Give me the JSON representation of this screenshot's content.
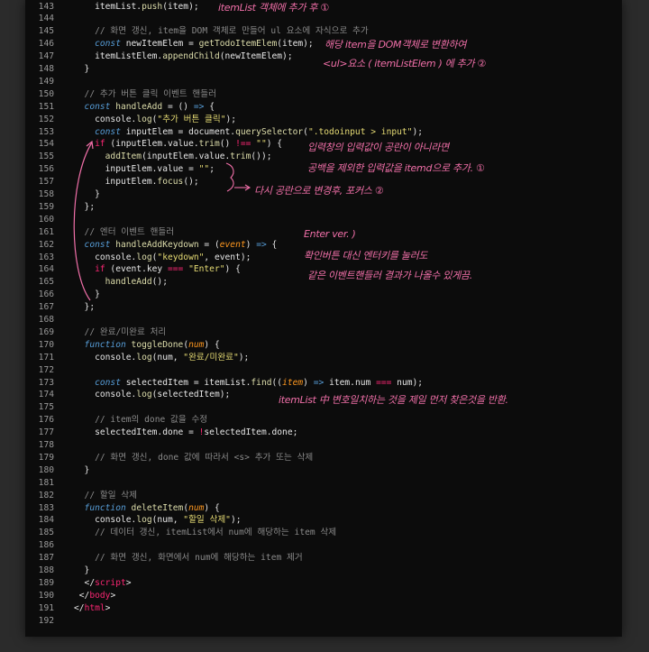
{
  "colors": {
    "background": "#0c0c0c",
    "line_number": "#9a9a9a",
    "plain": "#e6e6e6",
    "keyword": "#569cd6",
    "function": "#dcdcaa",
    "string": "#e6db74",
    "comment": "#8a8a8a",
    "param": "#fd971f",
    "operator": "#f92672",
    "annotation": "#f06fa8"
  },
  "code_lines": [
    {
      "n": "143",
      "tokens": [
        [
          "p",
          "    itemList."
        ],
        [
          "f",
          "push"
        ],
        [
          "p",
          "(item);"
        ]
      ]
    },
    {
      "n": "144",
      "tokens": []
    },
    {
      "n": "145",
      "tokens": [
        [
          "c",
          "    // 화면 갱신, item을 DOM 객체로 만들어 ul 요소에 자식으로 추가"
        ]
      ]
    },
    {
      "n": "146",
      "tokens": [
        [
          "k",
          "    const"
        ],
        [
          "p",
          " newItemElem = "
        ],
        [
          "f",
          "getTodoItemElem"
        ],
        [
          "p",
          "(item);"
        ]
      ]
    },
    {
      "n": "147",
      "tokens": [
        [
          "p",
          "    itemListElem."
        ],
        [
          "f",
          "appendChild"
        ],
        [
          "p",
          "(newItemElem);"
        ]
      ]
    },
    {
      "n": "148",
      "tokens": [
        [
          "p",
          "  }"
        ]
      ]
    },
    {
      "n": "149",
      "tokens": []
    },
    {
      "n": "150",
      "tokens": [
        [
          "c",
          "  // 추가 버튼 클릭 이벤트 핸들러"
        ]
      ]
    },
    {
      "n": "151",
      "tokens": [
        [
          "k",
          "  const"
        ],
        [
          "f",
          " handleAdd"
        ],
        [
          "p",
          " = () "
        ],
        [
          "k",
          "=>"
        ],
        [
          "p",
          " {"
        ]
      ]
    },
    {
      "n": "152",
      "tokens": [
        [
          "p",
          "    console."
        ],
        [
          "f",
          "log"
        ],
        [
          "p",
          "("
        ],
        [
          "s",
          "\"추가 버튼 클릭\""
        ],
        [
          "p",
          ");"
        ]
      ]
    },
    {
      "n": "153",
      "tokens": [
        [
          "k",
          "    const"
        ],
        [
          "p",
          " inputElem = document."
        ],
        [
          "f",
          "querySelector"
        ],
        [
          "p",
          "("
        ],
        [
          "s",
          "\".todoinput > input\""
        ],
        [
          "p",
          ");"
        ]
      ]
    },
    {
      "n": "154",
      "tokens": [
        [
          "o",
          "    if"
        ],
        [
          "p",
          " (inputElem.value."
        ],
        [
          "f",
          "trim"
        ],
        [
          "p",
          "() "
        ],
        [
          "o",
          "!=="
        ],
        [
          "p",
          " "
        ],
        [
          "s",
          "\"\""
        ],
        [
          "p",
          ") {"
        ]
      ]
    },
    {
      "n": "155",
      "tokens": [
        [
          "f",
          "      addItem"
        ],
        [
          "p",
          "(inputElem.value."
        ],
        [
          "f",
          "trim"
        ],
        [
          "p",
          "());"
        ]
      ]
    },
    {
      "n": "156",
      "tokens": [
        [
          "p",
          "      inputElem.value = "
        ],
        [
          "s",
          "\"\""
        ],
        [
          "p",
          ";"
        ]
      ]
    },
    {
      "n": "157",
      "tokens": [
        [
          "p",
          "      inputElem."
        ],
        [
          "f",
          "focus"
        ],
        [
          "p",
          "();"
        ]
      ]
    },
    {
      "n": "158",
      "tokens": [
        [
          "p",
          "    }"
        ]
      ]
    },
    {
      "n": "159",
      "tokens": [
        [
          "p",
          "  };"
        ]
      ]
    },
    {
      "n": "160",
      "tokens": []
    },
    {
      "n": "161",
      "tokens": [
        [
          "c",
          "  // 엔터 이벤트 핸들러"
        ]
      ]
    },
    {
      "n": "162",
      "tokens": [
        [
          "k",
          "  const"
        ],
        [
          "f",
          " handleAddKeydown"
        ],
        [
          "p",
          " = ("
        ],
        [
          "a",
          "event"
        ],
        [
          "p",
          ") "
        ],
        [
          "k",
          "=>"
        ],
        [
          "p",
          " {"
        ]
      ]
    },
    {
      "n": "163",
      "tokens": [
        [
          "p",
          "    console."
        ],
        [
          "f",
          "log"
        ],
        [
          "p",
          "("
        ],
        [
          "s",
          "\"keydown\""
        ],
        [
          "p",
          ", event);"
        ]
      ]
    },
    {
      "n": "164",
      "tokens": [
        [
          "o",
          "    if"
        ],
        [
          "p",
          " (event.key "
        ],
        [
          "o",
          "==="
        ],
        [
          "p",
          " "
        ],
        [
          "s",
          "\"Enter\""
        ],
        [
          "p",
          ") {"
        ]
      ]
    },
    {
      "n": "165",
      "tokens": [
        [
          "f",
          "      handleAdd"
        ],
        [
          "p",
          "();"
        ]
      ]
    },
    {
      "n": "166",
      "tokens": [
        [
          "p",
          "    }"
        ]
      ]
    },
    {
      "n": "167",
      "tokens": [
        [
          "p",
          "  };"
        ]
      ]
    },
    {
      "n": "168",
      "tokens": []
    },
    {
      "n": "169",
      "tokens": [
        [
          "c",
          "  // 완료/미완료 처리"
        ]
      ]
    },
    {
      "n": "170",
      "tokens": [
        [
          "k",
          "  function"
        ],
        [
          "f",
          " toggleDone"
        ],
        [
          "p",
          "("
        ],
        [
          "a",
          "num"
        ],
        [
          "p",
          ") {"
        ]
      ]
    },
    {
      "n": "171",
      "tokens": [
        [
          "p",
          "    console."
        ],
        [
          "f",
          "log"
        ],
        [
          "p",
          "(num, "
        ],
        [
          "s",
          "\"완료/미완료\""
        ],
        [
          "p",
          ");"
        ]
      ]
    },
    {
      "n": "172",
      "tokens": []
    },
    {
      "n": "173",
      "tokens": [
        [
          "k",
          "    const"
        ],
        [
          "p",
          " selectedItem = itemList."
        ],
        [
          "f",
          "find"
        ],
        [
          "p",
          "(("
        ],
        [
          "a",
          "item"
        ],
        [
          "p",
          ") "
        ],
        [
          "k",
          "=>"
        ],
        [
          "p",
          " item.num "
        ],
        [
          "o",
          "==="
        ],
        [
          "p",
          " num);"
        ]
      ]
    },
    {
      "n": "174",
      "tokens": [
        [
          "p",
          "    console."
        ],
        [
          "f",
          "log"
        ],
        [
          "p",
          "(selectedItem);"
        ]
      ]
    },
    {
      "n": "175",
      "tokens": []
    },
    {
      "n": "176",
      "tokens": [
        [
          "c",
          "    // item의 done 값을 수정"
        ]
      ]
    },
    {
      "n": "177",
      "tokens": [
        [
          "p",
          "    selectedItem.done = "
        ],
        [
          "o",
          "!"
        ],
        [
          "p",
          "selectedItem.done;"
        ]
      ]
    },
    {
      "n": "178",
      "tokens": []
    },
    {
      "n": "179",
      "tokens": [
        [
          "c",
          "    // 화면 갱신, done 값에 따라서 <s> 추가 또는 삭제"
        ]
      ]
    },
    {
      "n": "180",
      "tokens": [
        [
          "p",
          "  }"
        ]
      ]
    },
    {
      "n": "181",
      "tokens": []
    },
    {
      "n": "182",
      "tokens": [
        [
          "c",
          "  // 할일 삭제"
        ]
      ]
    },
    {
      "n": "183",
      "tokens": [
        [
          "k",
          "  function"
        ],
        [
          "f",
          " deleteItem"
        ],
        [
          "p",
          "("
        ],
        [
          "a",
          "num"
        ],
        [
          "p",
          ") {"
        ]
      ]
    },
    {
      "n": "184",
      "tokens": [
        [
          "p",
          "    console."
        ],
        [
          "f",
          "log"
        ],
        [
          "p",
          "(num, "
        ],
        [
          "s",
          "\"할일 삭제\""
        ],
        [
          "p",
          ");"
        ]
      ]
    },
    {
      "n": "185",
      "tokens": [
        [
          "c",
          "    // 데이터 갱신, itemList에서 num에 해당하는 item 삭제"
        ]
      ]
    },
    {
      "n": "186",
      "tokens": []
    },
    {
      "n": "187",
      "tokens": [
        [
          "c",
          "    // 화면 갱신, 화면에서 num에 해당하는 item 제거"
        ]
      ]
    },
    {
      "n": "188",
      "tokens": [
        [
          "p",
          "  }"
        ]
      ]
    },
    {
      "n": "189",
      "tokens": [
        [
          "p",
          "  </"
        ],
        [
          "t",
          "script"
        ],
        [
          "p",
          ">"
        ]
      ]
    },
    {
      "n": "190",
      "tokens": [
        [
          "p",
          " </"
        ],
        [
          "t",
          "body"
        ],
        [
          "p",
          ">"
        ]
      ]
    },
    {
      "n": "191",
      "tokens": [
        [
          "p",
          "</"
        ],
        [
          "t",
          "html"
        ],
        [
          "p",
          ">"
        ]
      ]
    },
    {
      "n": "192",
      "tokens": []
    }
  ],
  "annotations": {
    "push_note": "itemList 객체에 추가 후 ①",
    "dom_note_1": "해당 item을 DOM객체로 변환하여",
    "dom_note_2": "<ul>요소 ( itemListElem ) 에 추가 ②",
    "trim_note_1": "입력창의 입력값이 공란이 아니라면",
    "trim_note_2": "공백을 제외한 입력값을 itemd으로 추가. ①",
    "focus_note": "다시 공란으로 변경후, 포커스 ②",
    "enter_note_1": "Enter ver. )",
    "enter_note_2": "확인버튼 대신 엔터키를 눌러도",
    "enter_note_3": "같은 이벤트핸들러 결과가 나올수 있게끔.",
    "find_note": "itemList 中 변호일치하는 것을 제일 먼저 찾은것을 반환."
  }
}
